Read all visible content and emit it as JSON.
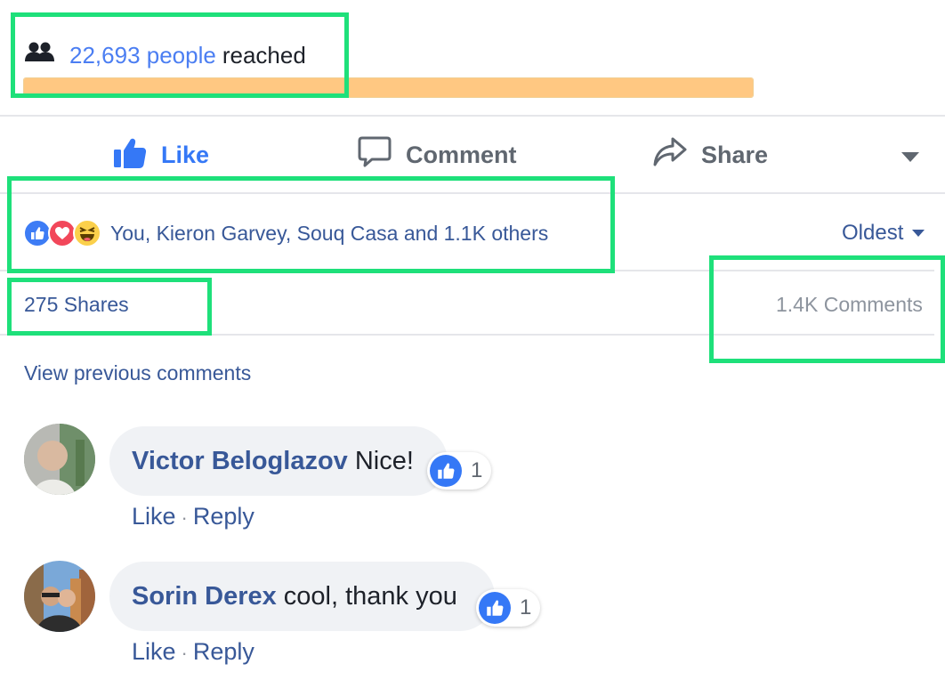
{
  "reach": {
    "count": "22,693 people",
    "suffix": "reached",
    "bar_fill_percent": 100
  },
  "actions": {
    "like": "Like",
    "comment": "Comment",
    "share": "Share"
  },
  "reactions": {
    "summary": "You, Kieron Garvey, Souq Casa and 1.1K others",
    "types": [
      "like-icon",
      "love-icon",
      "haha-icon"
    ]
  },
  "sort": {
    "label": "Oldest"
  },
  "stats": {
    "shares": "275 Shares",
    "comments": "1.4K Comments"
  },
  "view_previous": "View previous comments",
  "comments": [
    {
      "author": "Victor Beloglazov",
      "text": "Nice!",
      "likes": "1",
      "like_label": "Like",
      "reply_label": "Reply",
      "sep": "·"
    },
    {
      "author": "Sorin Derex",
      "text": "cool, thank you",
      "likes": "1",
      "like_label": "Like",
      "reply_label": "Reply",
      "sep": "·"
    }
  ],
  "colors": {
    "link_blue": "#385898",
    "like_blue": "#3578f6",
    "reach_blue": "#4b7ef2",
    "reach_bar": "#ffc882",
    "highlight_green": "#1ee07a"
  }
}
